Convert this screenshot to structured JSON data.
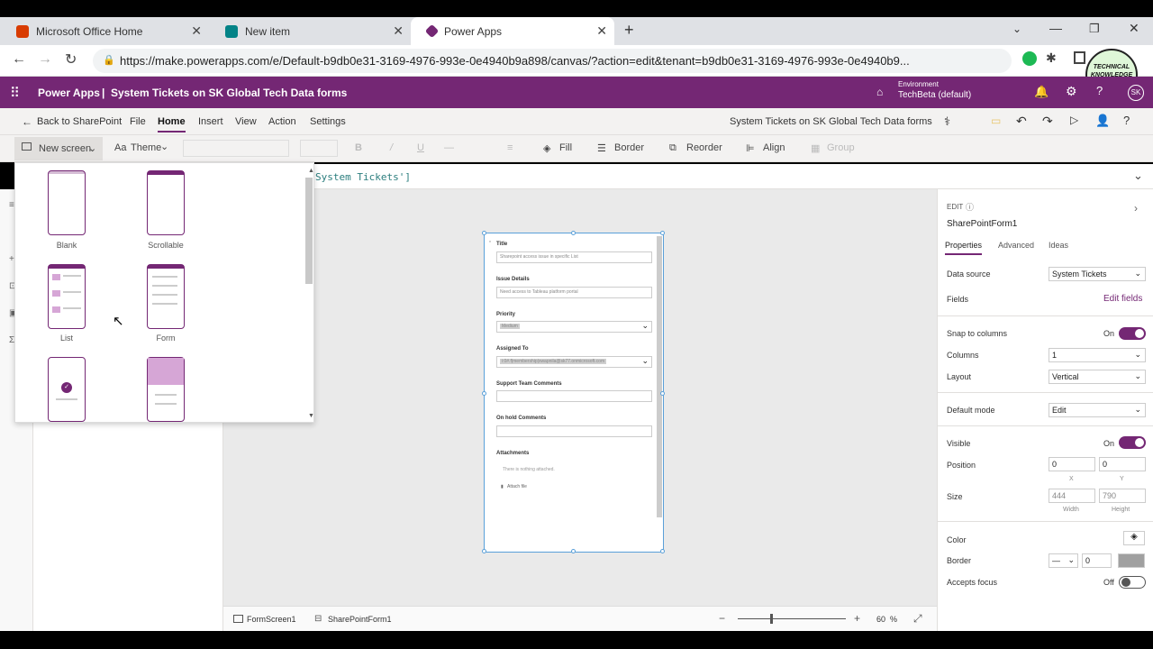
{
  "browser": {
    "tabs": [
      {
        "title": "Microsoft Office Home",
        "color": "#d83b01"
      },
      {
        "title": "New item",
        "color": "#038387"
      },
      {
        "title": "Power Apps",
        "color": "#742774"
      }
    ],
    "url": "https://make.powerapps.com/e/Default-b9db0e31-3169-4976-993e-0e4940b9a898/canvas/?action=edit&tenant=b9db0e31-3169-4976-993e-0e4940b9...",
    "watermark": "TECHNICAL KNOWLEDGE BETA"
  },
  "app": {
    "name": "Power Apps",
    "separator": "|",
    "title": "System Tickets on SK Global Tech Data forms",
    "environment_label": "Environment",
    "environment_value": "TechBeta (default)",
    "avatar": "SK",
    "accent": "#742774"
  },
  "menu": {
    "back": "Back to SharePoint",
    "items": [
      "File",
      "Home",
      "Insert",
      "View",
      "Action",
      "Settings"
    ],
    "active": "Home",
    "doc_title": "System Tickets on SK Global Tech Data forms"
  },
  "toolbar": {
    "new_screen": "New screen",
    "theme": "Theme",
    "fill": "Fill",
    "border": "Border",
    "reorder": "Reorder",
    "align": "Align",
    "group": "Group"
  },
  "formula": "System Tickets']",
  "screen_templates": [
    "Blank",
    "Scrollable",
    "List",
    "Form"
  ],
  "form": {
    "fields": [
      {
        "label": "Title",
        "value": "Sharepoint access issue in specific List"
      },
      {
        "label": "Issue Details",
        "value": "Need access to Tableau platform portal"
      },
      {
        "label": "Priority",
        "value": "Medium"
      },
      {
        "label": "Assigned To",
        "value": "i:0#.f|membership|swapnila@sk77.onmicrosoft.com"
      },
      {
        "label": "Support Team Comments",
        "value": ""
      },
      {
        "label": "On hold Comments",
        "value": ""
      }
    ],
    "attachments_label": "Attachments",
    "attachments_empty": "There is nothing attached.",
    "attach_file": "Attach file"
  },
  "bottom": {
    "screen": "FormScreen1",
    "control": "SharePointForm1",
    "zoom": "60",
    "zoom_unit": "%"
  },
  "panel": {
    "edit_label": "EDIT",
    "control_name": "SharePointForm1",
    "tabs": [
      "Properties",
      "Advanced",
      "Ideas"
    ],
    "data_source_label": "Data source",
    "data_source_value": "System Tickets",
    "fields_label": "Fields",
    "edit_fields": "Edit fields",
    "snap_label": "Snap to columns",
    "snap_value": "On",
    "columns_label": "Columns",
    "columns_value": "1",
    "layout_label": "Layout",
    "layout_value": "Vertical",
    "default_mode_label": "Default mode",
    "default_mode_value": "Edit",
    "visible_label": "Visible",
    "visible_value": "On",
    "position_label": "Position",
    "pos_x": "0",
    "pos_y": "0",
    "x_label": "X",
    "y_label": "Y",
    "size_label": "Size",
    "width": "444",
    "height": "790",
    "width_label": "Width",
    "height_label": "Height",
    "color_label": "Color",
    "border_label": "Border",
    "border_value": "0",
    "accepts_focus_label": "Accepts focus",
    "accepts_focus_value": "Off"
  }
}
